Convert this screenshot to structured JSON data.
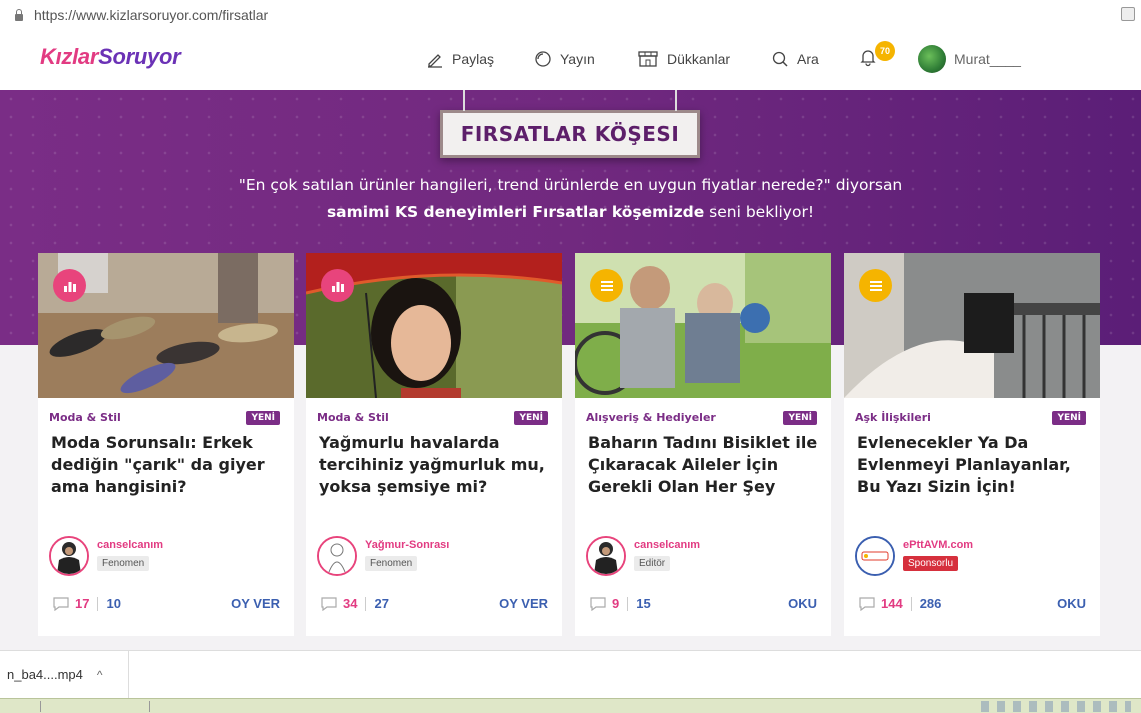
{
  "browser": {
    "url": "https://www.kizlarsoruyor.com/firsatlar"
  },
  "header": {
    "logo_part1": "Kızlar",
    "logo_part2": "Soruyor",
    "nav": {
      "share": "Paylaş",
      "broadcast": "Yayın",
      "shops": "Dükkanlar",
      "search": "Ara"
    },
    "notifications_count": "70",
    "username": "Murat____"
  },
  "hero": {
    "sign": "FIRSATLAR KÖŞESI",
    "line1": "\"En çok satılan ürünler hangileri, trend ürünlerde en uygun fiyatlar nerede?\" diyorsan",
    "line2_bold": "samimi KS deneyimleri Fırsatlar köşemizde",
    "line2_rest": " seni bekliyor!",
    "colors": {
      "primary": "#7a2d86",
      "accent": "#e23b82",
      "link": "#3b5fb0"
    }
  },
  "cards": [
    {
      "category": "Moda & Stil",
      "badge": "YENİ",
      "title": "Moda Sorunsalı: Erkek dediğin \"çarık\" da giyer ama hangisini?",
      "author": "canselcanım",
      "role": "Fenomen",
      "comments": "17",
      "votes": "10",
      "action": "OY VER",
      "type_icon": "poll-icon",
      "icon_color": "#e8447c"
    },
    {
      "category": "Moda & Stil",
      "badge": "YENİ",
      "title": "Yağmurlu havalarda tercihiniz yağmurluk mu, yoksa şemsiye mi?",
      "author": "Yağmur-Sonrası",
      "role": "Fenomen",
      "comments": "34",
      "votes": "27",
      "action": "OY VER",
      "type_icon": "poll-icon",
      "icon_color": "#e8447c"
    },
    {
      "category": "Alışveriş & Hediyeler",
      "badge": "YENİ",
      "title": "Baharın Tadını Bisiklet ile Çıkaracak Aileler İçin Gerekli Olan Her Şey",
      "author": "canselcanım",
      "role": "Editör",
      "comments": "9",
      "votes": "15",
      "action": "OKU",
      "type_icon": "list-icon",
      "icon_color": "#f5b400"
    },
    {
      "category": "Aşk İlişkileri",
      "badge": "YENİ",
      "title": "Evlenecekler Ya Da Evlenmeyi Planlayanlar, Bu Yazı Sizin İçin!",
      "author": "ePttAVM.com",
      "role": "Sponsorlu",
      "comments": "144",
      "votes": "286",
      "action": "OKU",
      "type_icon": "list-icon",
      "icon_color": "#f5b400"
    }
  ],
  "downloads": {
    "file": "n_ba4....mp4"
  }
}
